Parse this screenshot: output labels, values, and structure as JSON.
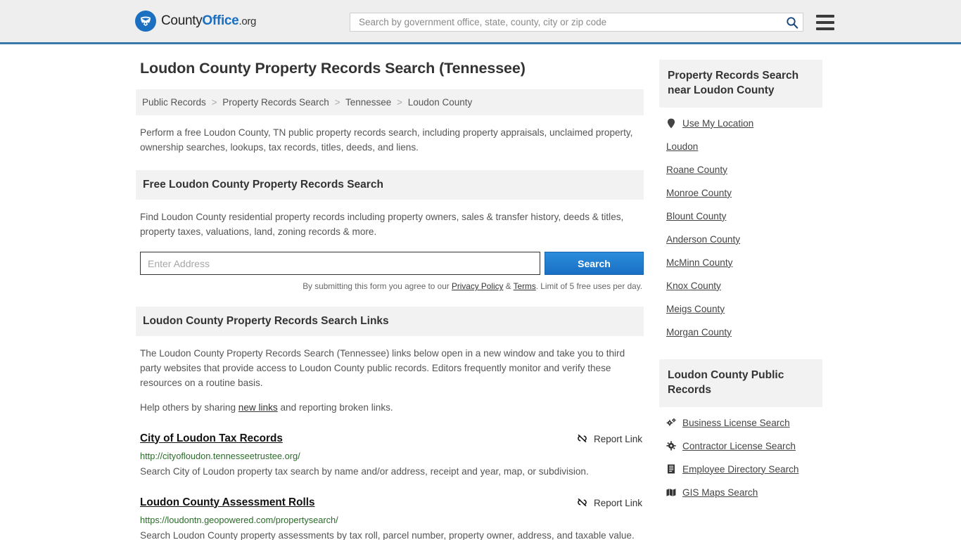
{
  "header": {
    "logo": {
      "part1": "County",
      "part2": "Office",
      "part3": ".org",
      "icon": "eagle-shield-icon"
    },
    "search": {
      "placeholder": "Search by government office, state, county, city or zip code",
      "value": "",
      "icon": "search-icon"
    },
    "menu_icon": "hamburger-menu-icon",
    "accent_color": "#3878a8"
  },
  "main": {
    "title": "Loudon County Property Records Search (Tennessee)",
    "breadcrumb": [
      "Public Records",
      "Property Records Search",
      "Tennessee",
      "Loudon County"
    ],
    "breadcrumb_separator": ">",
    "intro": "Perform a free Loudon County, TN public property records search, including property appraisals, unclaimed property, ownership searches, lookups, tax records, titles, deeds, and liens.",
    "free_search": {
      "heading": "Free Loudon County Property Records Search",
      "description": "Find Loudon County residential property records including property owners, sales & transfer history, deeds & titles, property taxes, valuations, land, zoning records & more.",
      "input_placeholder": "Enter Address",
      "input_value": "",
      "button_label": "Search",
      "legal_prefix": "By submitting this form you agree to our ",
      "legal_privacy": "Privacy Policy",
      "legal_amp": " & ",
      "legal_terms": "Terms",
      "legal_suffix": ". Limit of 5 free uses per day."
    },
    "links_section": {
      "heading": "Loudon County Property Records Search Links",
      "description": "The Loudon County Property Records Search (Tennessee) links below open in a new window and take you to third party websites that provide access to Loudon County public records. Editors frequently monitor and verify these resources on a routine basis.",
      "help_prefix": "Help others by sharing ",
      "help_link": "new links",
      "help_suffix": " and reporting broken links.",
      "report_label": "Report Link",
      "report_icon": "broken-link-icon",
      "entries": [
        {
          "title": "City of Loudon Tax Records",
          "url": "http://cityofloudon.tennesseetrustee.org/",
          "description": "Search City of Loudon property tax search by name and/or address, receipt and year, map, or subdivision."
        },
        {
          "title": "Loudon County Assessment Rolls",
          "url": "https://loudontn.geopowered.com/propertysearch/",
          "description": "Search Loudon County property assessments by tax roll, parcel number, property owner, address, and taxable value."
        }
      ]
    }
  },
  "sidebar": {
    "nearby": {
      "heading": "Property Records Search near Loudon County",
      "items": [
        {
          "label": "Use My Location",
          "icon": "location-pin-icon"
        },
        {
          "label": "Loudon",
          "icon": ""
        },
        {
          "label": "Roane County",
          "icon": ""
        },
        {
          "label": "Monroe County",
          "icon": ""
        },
        {
          "label": "Blount County",
          "icon": ""
        },
        {
          "label": "Anderson County",
          "icon": ""
        },
        {
          "label": "McMinn County",
          "icon": ""
        },
        {
          "label": "Knox County",
          "icon": ""
        },
        {
          "label": "Meigs County",
          "icon": ""
        },
        {
          "label": "Morgan County",
          "icon": ""
        }
      ]
    },
    "public_records": {
      "heading": "Loudon County Public Records",
      "items": [
        {
          "label": "Business License Search",
          "icon": "gears-icon"
        },
        {
          "label": "Contractor License Search",
          "icon": "gear-icon"
        },
        {
          "label": "Employee Directory Search",
          "icon": "book-icon"
        },
        {
          "label": "GIS Maps Search",
          "icon": "map-icon"
        }
      ]
    }
  }
}
